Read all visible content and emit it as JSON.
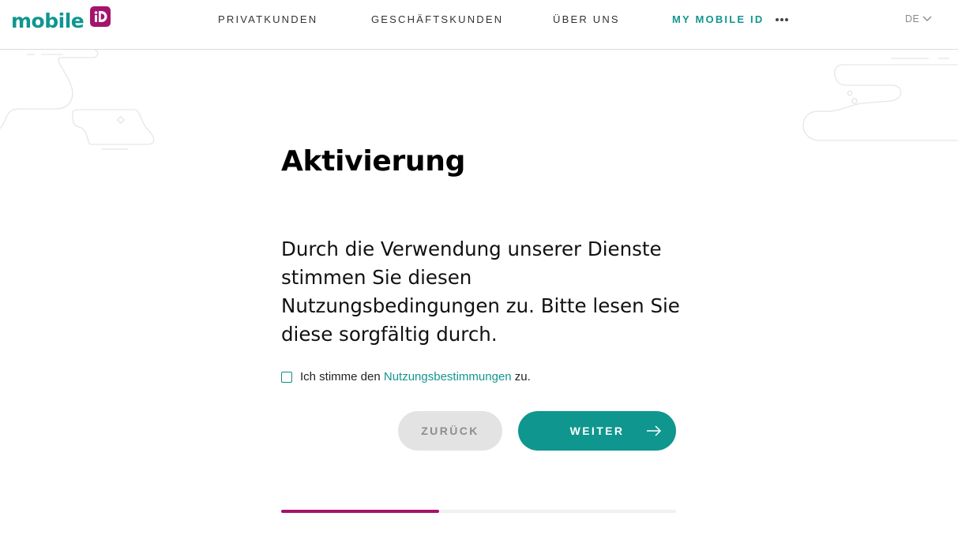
{
  "header": {
    "logo_text": "mobile",
    "nav": [
      {
        "label": "PRIVATKUNDEN"
      },
      {
        "label": "GESCHÄFTSKUNDEN"
      },
      {
        "label": "ÜBER UNS"
      },
      {
        "label": "MY MOBILE ID"
      }
    ],
    "more_icon": "more-horizontal-icon",
    "language": "DE"
  },
  "main": {
    "title": "Aktivierung",
    "body": "Durch die Verwendung unserer Dienste stimmen Sie diesen Nutzungsbedingungen zu. Bitte lesen Sie diese sorgfältig durch.",
    "consent": {
      "checked": false,
      "prefix": "Ich stimme den ",
      "link": "Nutzungsbestimmungen",
      "suffix": " zu."
    },
    "buttons": {
      "back": "ZURÜCK",
      "next": "WEITER"
    },
    "progress": 0.4
  },
  "colors": {
    "accent": "#0f968f",
    "brand": "#a4136c",
    "button_disabled": "#e3e3e3"
  }
}
